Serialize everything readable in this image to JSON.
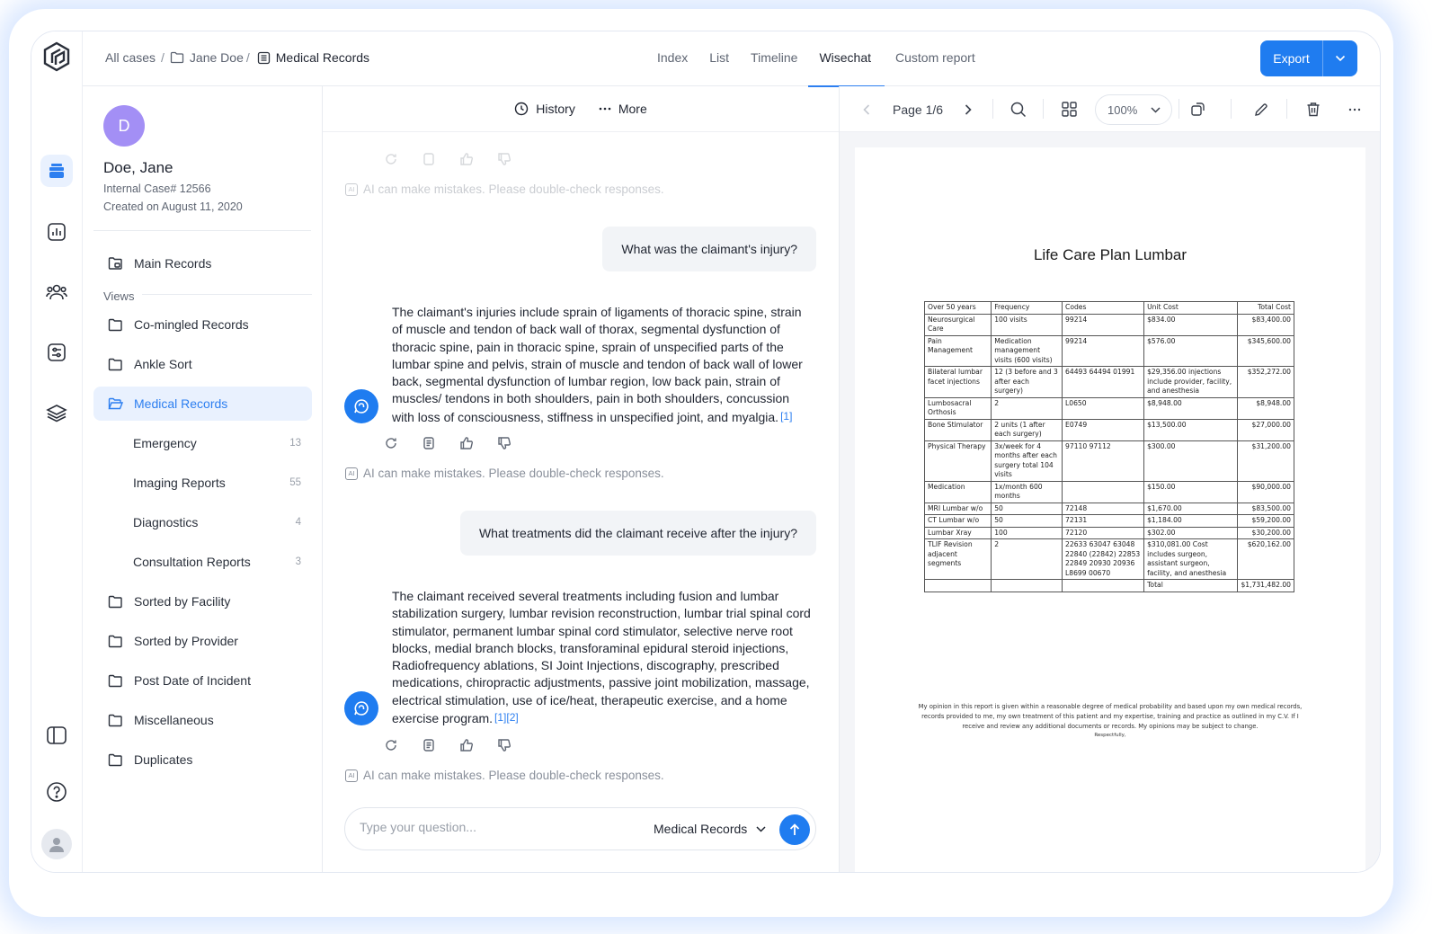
{
  "header": {
    "breadcrumb": {
      "all_cases": "All cases",
      "sep": "/",
      "case": "Jane Doe",
      "current": "Medical Records"
    },
    "tabs": [
      "Index",
      "List",
      "Timeline",
      "Wisechat",
      "Custom report"
    ],
    "active_tab": "Wisechat",
    "export_label": "Export"
  },
  "patient": {
    "initial": "D",
    "name": "Doe, Jane",
    "case_number": "Internal Case# 12566",
    "created": "Created on  August 11, 2020"
  },
  "sidebar": {
    "main_records": "Main Records",
    "views_label": "Views",
    "items": [
      {
        "label": "Co-mingled Records"
      },
      {
        "label": "Ankle Sort"
      },
      {
        "label": "Medical Records",
        "active": true
      },
      {
        "label": "Emergency",
        "count": "13"
      },
      {
        "label": "Imaging Reports",
        "count": "55"
      },
      {
        "label": "Diagnostics",
        "count": "4"
      },
      {
        "label": "Consultation Reports",
        "count": "3"
      },
      {
        "label": "Sorted by Facility"
      },
      {
        "label": "Sorted by Provider"
      },
      {
        "label": "Post Date of Incident"
      },
      {
        "label": "Miscellaneous"
      },
      {
        "label": "Duplicates"
      }
    ]
  },
  "chat": {
    "toolbar": {
      "history": "History",
      "more": "More"
    },
    "disclaimer": "AI can make mistakes. Please double-check responses.",
    "ai_badge": "AI",
    "messages": [
      {
        "question": "What was the claimant's injury?",
        "answer": "The claimant's injuries include sprain of ligaments of thoracic spine, strain of muscle and tendon of back wall of thorax, segmental dysfunction of thoracic spine, pain in thoracic spine, sprain of unspecified parts of the lumbar spine and pelvis, strain of muscle and tendon of back wall of lower back, segmental dysfunction of lumbar region, low back pain, strain of muscles/ tendons in both shoulders, pain in both shoulders, concussion with loss of consciousness, stiffness in unspecified joint, and myalgia.",
        "refs": "[1]"
      },
      {
        "question": "What treatments did the claimant receive after the injury?",
        "answer": "The claimant received several treatments including fusion and lumbar stabilization surgery, lumbar revision reconstruction, lumbar trial spinal cord stimulator, permanent lumbar spinal cord stimulator, selective nerve root blocks, medial branch blocks, transforaminal epidural steroid injections, Radiofrequency ablations, SI Joint Injections, discography, prescribed medications, chiropractic adjustments, passive joint mobilization, massage, electrical stimulation, use of ice/heat, therapeutic exercise, and a home exercise program.",
        "refs": "[1][2]"
      }
    ],
    "input_placeholder": "Type your question...",
    "scope": "Medical Records"
  },
  "viewer": {
    "page_label": "Page 1/6",
    "zoom": "100%",
    "doc_title": "Life Care Plan Lumbar",
    "table": {
      "headers": [
        "Over 50 years",
        "Frequency",
        "Codes",
        "Unit Cost",
        "Total Cost"
      ],
      "rows": [
        [
          "Neurosurgical Care",
          "100 visits",
          "99214",
          "$834.00",
          "$83,400.00"
        ],
        [
          "Pain Management",
          "Medication management visits (600 visits)",
          "99214",
          "$576.00",
          "$345,600.00"
        ],
        [
          "Bilateral lumbar facet injections",
          "12 (3 before and 3 after each surgery)",
          "64493 64494 01991",
          "$29,356.00 injections include provider, facility, and anesthesia",
          "$352,272.00"
        ],
        [
          "Lumbosacral Orthosis",
          "2",
          "L0650",
          "$8,948.00",
          "$8,948.00"
        ],
        [
          "Bone Stimulator",
          "2 units (1 after each surgery)",
          "E0749",
          "$13,500.00",
          "$27,000.00"
        ],
        [
          "Physical Therapy",
          "3x/week for 4 months after each surgery total 104 visits",
          "97110 97112",
          "$300.00",
          "$31,200.00"
        ],
        [
          "Medication",
          "1x/month 600 months",
          "",
          "$150.00",
          "$90,000.00"
        ],
        [
          "MRI Lumbar w/o",
          "50",
          "72148",
          "$1,670.00",
          "$83,500.00"
        ],
        [
          "CT Lumbar w/o",
          "50",
          "72131",
          "$1,184.00",
          "$59,200.00"
        ],
        [
          "Lumbar Xray",
          "100",
          "72120",
          "$302.00",
          "$30,200.00"
        ],
        [
          "TLIF Revision adjacent segments",
          "2",
          "22633 63047 63048 22840 (22842) 22853 22849 20930 20936 L8699 00670",
          "$310,081.00 Cost includes surgeon, assistant surgeon, facility, and anesthesia",
          "$620,162.00"
        ],
        [
          "",
          "",
          "",
          "Total",
          "$1,731,482.00"
        ]
      ]
    },
    "opinion": "My opinion in this report is given within a reasonable degree of medical probability and based upon my own medical records, records provided to me, my own treatment of this patient and my expertise, training and practice as outlined in my C.V. If I receive and review any additional documents or records. My opinions may be subject to change.",
    "signoff": "Respectfully,"
  }
}
